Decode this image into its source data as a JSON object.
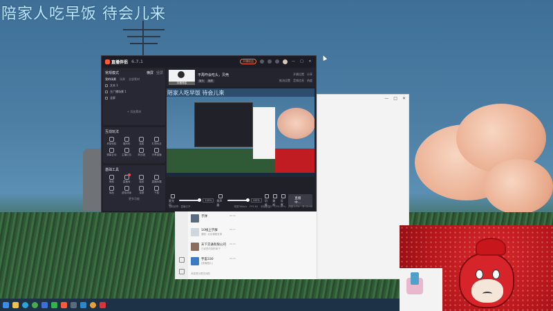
{
  "overlay": {
    "title": "陪家人吃早饭 待会儿来"
  },
  "app": {
    "name": "直播伴侣",
    "version": "6.7.1",
    "titlebar": {
      "pill": "开播权益",
      "controls": [
        "—",
        "□",
        "✕"
      ]
    },
    "scene": {
      "label": "常规模式",
      "tabs": [
        "横屏",
        "竖屏"
      ],
      "subtabs": [
        "我的场景",
        "场景",
        "全部素材"
      ],
      "sources": [
        "文本 1",
        "主广播场景 1",
        "全屏"
      ],
      "add_source": "+ 添加素材"
    },
    "interaction": {
      "title": "互动玩法",
      "items": [
        "贵族特权",
        "福利码",
        "连麦",
        "礼物玩法",
        "弹幕互动",
        "主播红包",
        "粉丝团",
        "分享直播"
      ]
    },
    "tools": {
      "title": "基础工具",
      "items": [
        "美颜",
        "直播间",
        "抽奖",
        "直播标题",
        "商品",
        "虚拟背景",
        "录屏",
        "下载"
      ]
    },
    "more": "更多功能",
    "room": {
      "thumb_caption": "抖音伴侣",
      "title": "不再咋会吃头，贝壳",
      "tags": [
        "娱乐",
        "横屏"
      ],
      "right_top": [
        "开播设置",
        "分享"
      ],
      "right_bottom": [
        "推流设置",
        "音频信息",
        "热度"
      ]
    },
    "preview": {
      "title": "陪家人吃早饭 待会儿来"
    },
    "controls": {
      "mic": "麦克风",
      "mic_vol": "100%",
      "speaker": "扬声器",
      "speaker_vol": "100%",
      "scene": "切换",
      "effect": "美颜",
      "settings": "设置",
      "live_button": "直播中..."
    },
    "status": {
      "left": "当前帧率：直播已开",
      "right": [
        "带宽38kb/s",
        "FPS 60",
        "丢帧数量0",
        "CPU 27%",
        "内存 17%",
        "开 12:00"
      ]
    }
  },
  "dialog": {
    "controls": [
      "—",
      "□",
      "✕"
    ]
  },
  "list": {
    "items": [
      {
        "title": "子弹",
        "sub": "",
        "time": "06:29"
      },
      {
        "title": "10线上学群",
        "sub": "通知: 北京课程安排",
        "time": "06:27"
      },
      {
        "title": "天下交通有限公司",
        "sub": "已经签约到的单子",
        "time": "06:25"
      },
      {
        "title": "宇宙330",
        "sub": "[表情图片]",
        "time": "06:24"
      }
    ],
    "bottom": "消息提示是关闭的"
  },
  "colors": {
    "accent": "#ff5a3c",
    "app_bg": "#1f2028",
    "mascot_red": "#c8161d"
  }
}
